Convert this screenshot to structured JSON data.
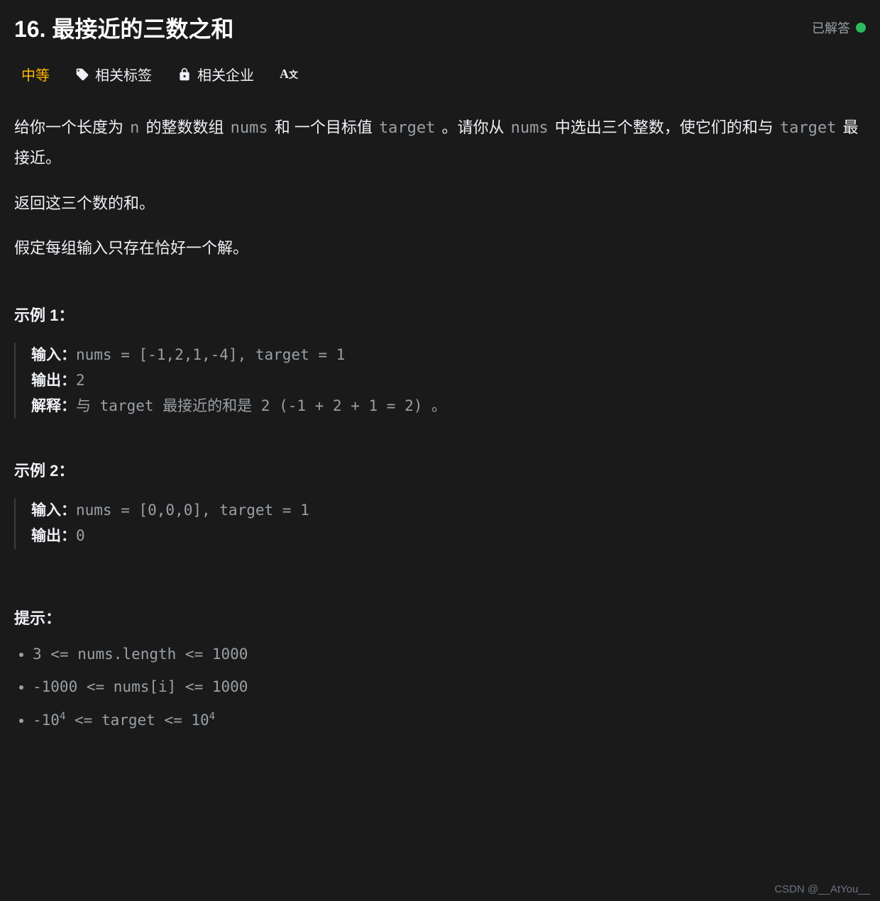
{
  "header": {
    "title": "16. 最接近的三数之和",
    "solved_label": "已解答"
  },
  "tabs": {
    "difficulty": "中等",
    "tags": "相关标签",
    "companies": "相关企业"
  },
  "description": {
    "p1_a": "给你一个长度为 ",
    "p1_code1": "n",
    "p1_b": " 的整数数组 ",
    "p1_code2": "nums",
    "p1_c": " 和 一个目标值 ",
    "p1_code3": "target",
    "p1_d": " 。请你从 ",
    "p1_code4": "nums",
    "p1_e": " 中选出三个整数，使它们的和与 ",
    "p1_code5": "target",
    "p1_f": " 最接近。",
    "p2": "返回这三个数的和。",
    "p3": "假定每组输入只存在恰好一个解。"
  },
  "examples_title1": "示例 1：",
  "examples_title2": "示例 2：",
  "labels": {
    "input": "输入：",
    "output": "输出：",
    "explain": "解释："
  },
  "example1": {
    "input": "nums = [-1,2,1,-4], target = 1",
    "output": "2",
    "explain": "与 target 最接近的和是 2 (-1 + 2 + 1 = 2) 。"
  },
  "example2": {
    "input": "nums = [0,0,0], target = 1",
    "output": "0"
  },
  "hints_title": "提示：",
  "constraints": [
    "3 <= nums.length <= 1000",
    "-1000 <= nums[i] <= 1000"
  ],
  "constraint3_a": "-10",
  "constraint3_sup": "4",
  "constraint3_b": " <= target <= 10",
  "watermark": "CSDN @__AtYou__"
}
